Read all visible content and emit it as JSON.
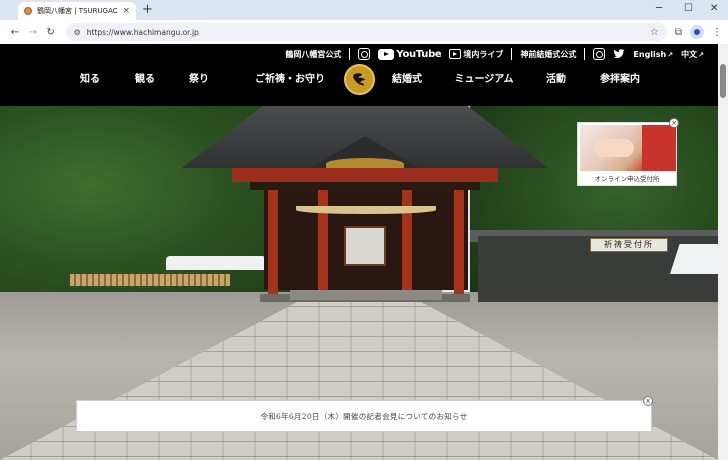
{
  "browser": {
    "tab_title": "鶴岡八幡宮 | TSURUGAOKAHACHIMANGU",
    "tab_close": "×",
    "new_tab": "+",
    "minimize": "─",
    "maximize": "☐",
    "close": "✕",
    "back": "←",
    "forward": "→",
    "reload": "↻",
    "url": "https://www.hachimangu.or.jp",
    "star": "☆",
    "menu": "⋮"
  },
  "header": {
    "official_label": "鶴岡八幡宮公式",
    "youtube_label": "YouTube",
    "live_label": "境内ライブ",
    "wedding_official_label": "神前結婚式公式",
    "english_label": "English",
    "chinese_label": "中文",
    "ext_arrow": "↗"
  },
  "nav": {
    "items": [
      "知る",
      "観る",
      "祭り",
      "ご祈祷・お守り",
      "結婚式",
      "ミュージアム",
      "活動",
      "参拝案内"
    ]
  },
  "hero": {
    "sign_text": "祈祷受付所"
  },
  "promo": {
    "label": "オンライン申込受付所",
    "close": "×"
  },
  "notice": {
    "text": "令和6年6月20日（木）開催の記者会見についてのお知らせ",
    "close": "×"
  },
  "colors": {
    "accent_gold": "#c99b24",
    "shrine_red": "#a53219",
    "header_bg": "#000000"
  },
  "icons": [
    "instagram-icon",
    "youtube-icon",
    "live-camera-icon",
    "twitter-icon",
    "crest-icon",
    "external-link-icon",
    "close-icon"
  ]
}
